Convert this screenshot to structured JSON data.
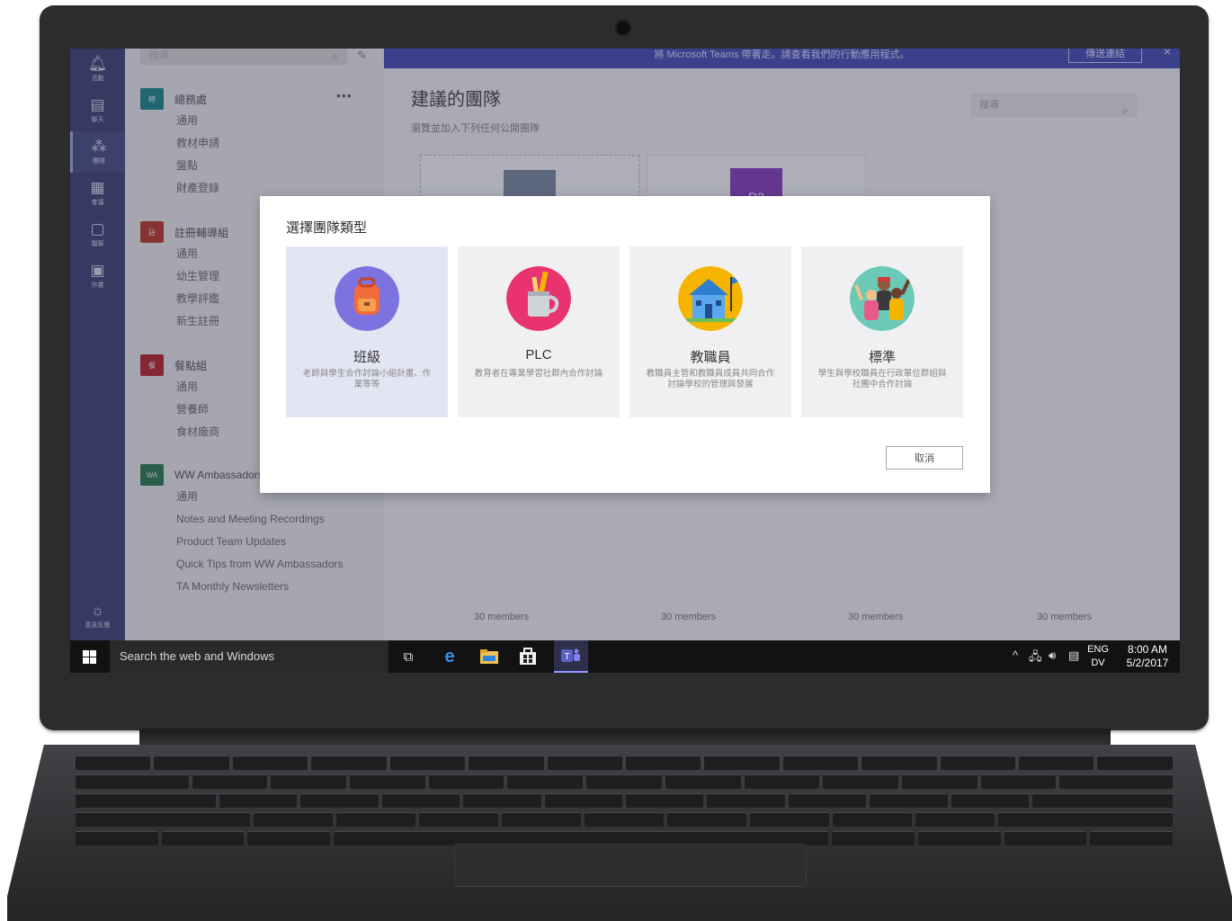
{
  "left_rail": {
    "items": [
      {
        "label": "活動",
        "icon": "bell-icon"
      },
      {
        "label": "聊天",
        "icon": "chat-icon"
      },
      {
        "label": "團隊",
        "icon": "teams-icon"
      },
      {
        "label": "會議",
        "icon": "calendar-icon"
      },
      {
        "label": "檔案",
        "icon": "file-icon"
      },
      {
        "label": "作業",
        "icon": "assignment-icon"
      }
    ],
    "bottom_item": {
      "label": "意見反應",
      "icon": "lightbulb-icon"
    }
  },
  "team_pane": {
    "search_placeholder": "搜尋",
    "teams": [
      {
        "avatar": "總",
        "avatar_color": "#1a8c8c",
        "name": "總務處",
        "channels": [
          "通用",
          "教材申請",
          "盤點",
          "財產登錄"
        ]
      },
      {
        "avatar": "註",
        "avatar_color": "#c0392b",
        "name": "註冊輔導組",
        "channels": [
          "通用",
          "幼生管理",
          "教學評鑑",
          "新生註冊"
        ]
      },
      {
        "avatar": "餐",
        "avatar_color": "#c0242b",
        "name": "餐點組",
        "channels": [
          "通用",
          "營養師",
          "食材廠商"
        ]
      },
      {
        "avatar": "WA",
        "avatar_color": "#2e7d4f",
        "name": "WW Ambassadors",
        "channels": [
          "通用",
          "Notes and Meeting Recordings",
          "Product Team Updates",
          "Quick Tips from WW Ambassadors",
          "TA Monthly Newsletters"
        ]
      }
    ]
  },
  "main": {
    "banner_text": "將 Microsoft Teams 帶著走。請查看我們的行動應用程式。",
    "banner_button": "傳送連結",
    "banner_close": "×",
    "title": "建議的團隊",
    "subtitle": "瀏覽並加入下列任何公開團隊",
    "search_placeholder": "搜尋",
    "peek_badge": "R2",
    "members_label": "30 members"
  },
  "dialog": {
    "title": "選擇團隊類型",
    "cards": [
      {
        "name": "班級",
        "desc": "老師與學生合作討論小組計畫、作業等等",
        "icon": "backpack-icon",
        "color": "#7c72e0"
      },
      {
        "name": "PLC",
        "desc": "教育者在專業學習社群內合作討論",
        "icon": "pencil-cup-icon",
        "color": "#e8336f"
      },
      {
        "name": "教職員",
        "desc": "教職員主管和教職員成員共同合作討論學校的管理與發展",
        "icon": "school-building-icon",
        "color": "#f4b400"
      },
      {
        "name": "標準",
        "desc": "學生與學校職員在行政單位群組與社團中合作討論",
        "icon": "people-group-icon",
        "color": "#6bc9b8"
      }
    ],
    "cancel": "取消"
  },
  "taskbar": {
    "search": "Search the web and Windows",
    "icons": [
      "task-view-icon",
      "edge-icon",
      "file-explorer-icon",
      "store-icon",
      "teams-app-icon"
    ],
    "lang_top": "ENG",
    "lang_bottom": "DV",
    "time": "8:00 AM",
    "date": "5/2/2017"
  }
}
